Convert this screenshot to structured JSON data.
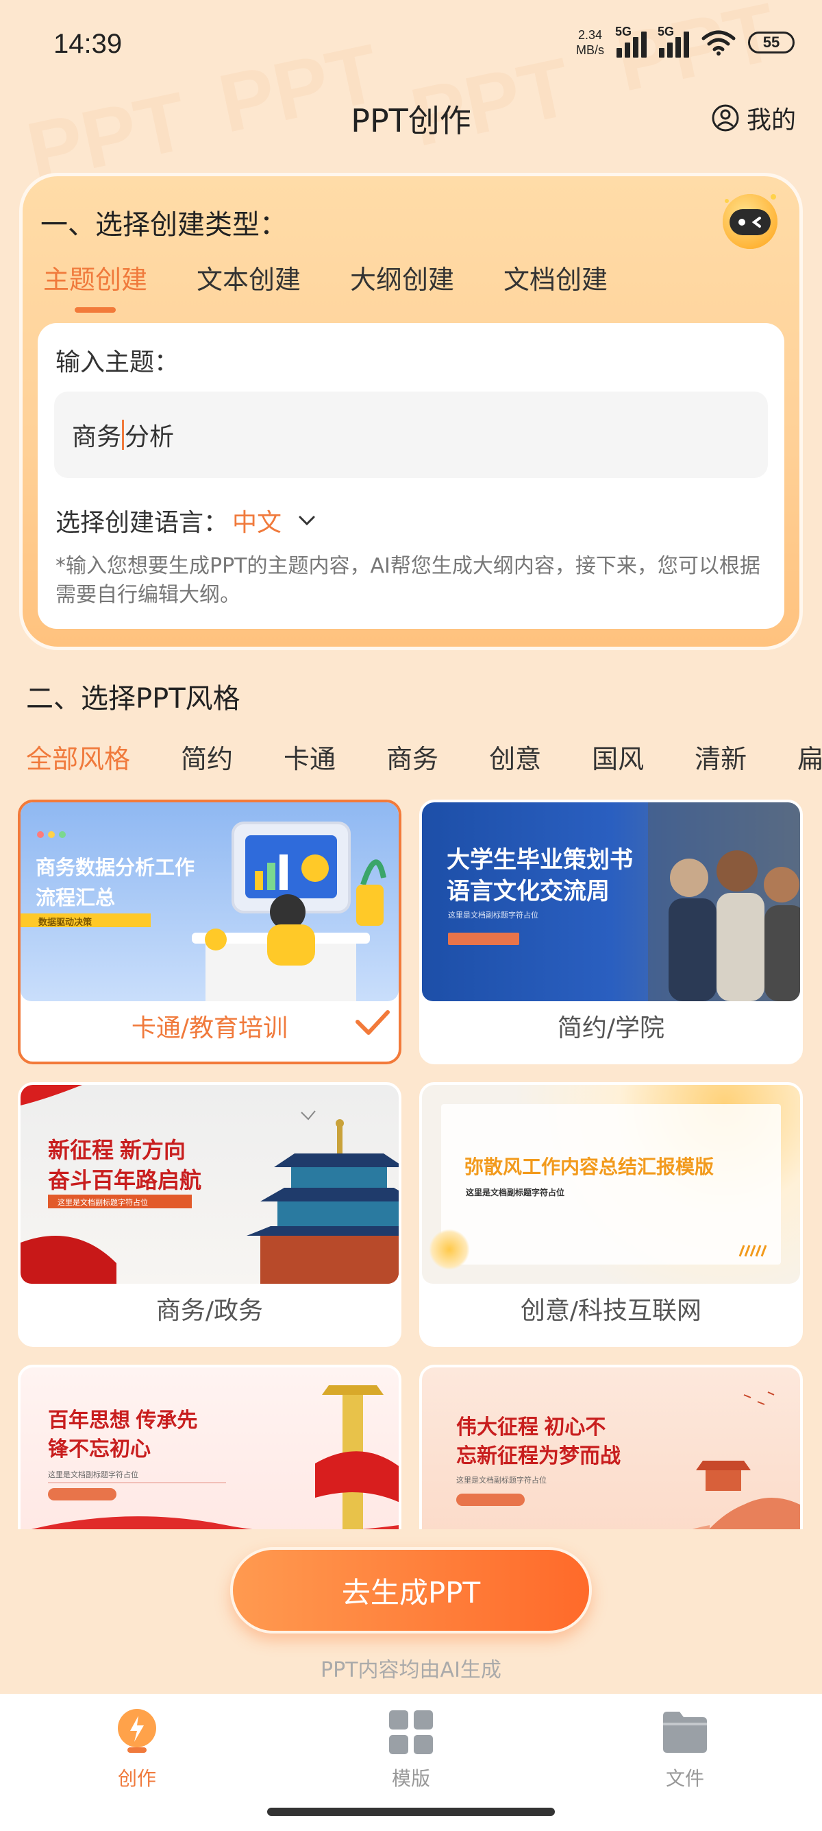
{
  "status_bar": {
    "time": "14:39",
    "net_speed_value": "2.34",
    "net_speed_unit": "MB/s",
    "signal1_label": "5G",
    "signal2_label": "5G",
    "battery": "55",
    "icons": [
      "signal-icon",
      "wifi-icon",
      "battery-icon"
    ]
  },
  "header": {
    "title": "PPT创作",
    "mine_label": "我的"
  },
  "create_type": {
    "title": "一、选择创建类型：",
    "tabs": [
      "主题创建",
      "文本创建",
      "大纲创建",
      "文档创建"
    ],
    "active_tab": 0,
    "input_label": "输入主题：",
    "input_value_before_caret": "商务",
    "input_value_after_caret": "分析",
    "language_label": "选择创建语言：",
    "language_value": "中文",
    "hint": "*输入您想要生成PPT的主题内容，AI帮您生成大纲内容，接下来，您可以根据需要自行编辑大纲。"
  },
  "style": {
    "title": "二、选择PPT风格",
    "tabs": [
      "全部风格",
      "简约",
      "卡通",
      "商务",
      "创意",
      "国风",
      "清新",
      "扁"
    ],
    "active_tab": 0,
    "templates": [
      {
        "label": "卡通/教育培训",
        "thumb_title_1": "商务数据分析工作",
        "thumb_title_2": "流程汇总",
        "thumb_tag": "数据驱动决策",
        "selected": true
      },
      {
        "label": "简约/学院",
        "thumb_title_1": "大学生毕业策划书",
        "thumb_title_2": "语言文化交流周",
        "thumb_sub": "这里是文档副标题字符占位",
        "selected": false
      },
      {
        "label": "商务/政务",
        "thumb_title_1": "新征程 新方向",
        "thumb_title_2": "奋斗百年路启航",
        "thumb_sub": "这里是文档副标题字符占位",
        "selected": false
      },
      {
        "label": "创意/科技互联网",
        "thumb_title_1": "弥散风工作内容总结汇报模版",
        "thumb_sub": "这里是文档副标题字符占位",
        "selected": false
      },
      {
        "label": "",
        "thumb_title_1": "百年思想 传承先",
        "thumb_title_2": "锋不忘初心",
        "thumb_sub": "这里是文档副标题字符占位",
        "selected": false
      },
      {
        "label": "",
        "thumb_title_1": "伟大征程 初心不",
        "thumb_title_2": "忘新征程为梦而战",
        "thumb_sub": "这里是文档副标题字符占位",
        "selected": false
      }
    ]
  },
  "generate": {
    "button_label": "去生成PPT",
    "note": "PPT内容均由AI生成"
  },
  "bottom_nav": {
    "items": [
      {
        "label": "创作",
        "icon": "lightning-icon",
        "active": true
      },
      {
        "label": "模版",
        "icon": "grid-icon",
        "active": false
      },
      {
        "label": "文件",
        "icon": "folder-icon",
        "active": false
      }
    ]
  },
  "colors": {
    "accent": "#f07a3c",
    "background": "#fde7cf",
    "button_gradient_start": "#ff9a50",
    "button_gradient_end": "#ff6a2a"
  }
}
